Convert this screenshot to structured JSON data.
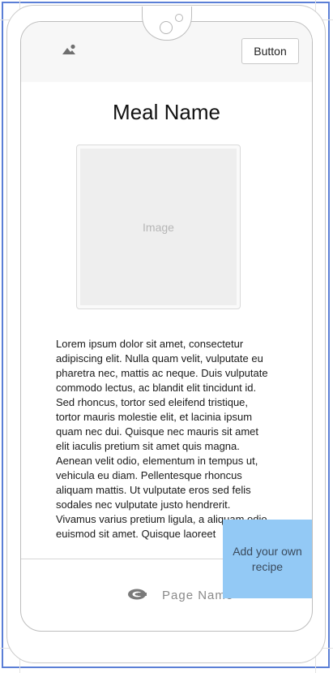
{
  "header": {
    "button_label": "Button"
  },
  "meal": {
    "title": "Meal Name",
    "image_placeholder": "Image",
    "description": "Lorem ipsum dolor sit amet, consectetur adipiscing elit. Nulla quam velit, vulputate eu pharetra nec, mattis ac neque. Duis vulputate commodo lectus, ac blandit elit tincidunt id. Sed rhoncus, tortor sed eleifend tristique, tortor mauris molestie elit, et lacinia ipsum quam nec dui. Quisque nec mauris sit amet elit iaculis pretium sit amet quis magna. Aenean velit odio, elementum in tempus ut, vehicula eu diam. Pellentesque rhoncus aliquam mattis. Ut vulputate eros sed felis sodales nec vulputate justo hendrerit. Vivamus varius pretium ligula, a aliquam odio euismod sit amet. Quisque laoreet"
  },
  "bottom_nav": {
    "page_name": "Page Name",
    "icon": "brand-c-icon"
  },
  "floating_action": {
    "label": "Add your own recipe"
  },
  "icons": {
    "logo": "image-landscape-icon"
  },
  "colors": {
    "accent": "#93c9f5",
    "frame": "#5b7fd6"
  }
}
